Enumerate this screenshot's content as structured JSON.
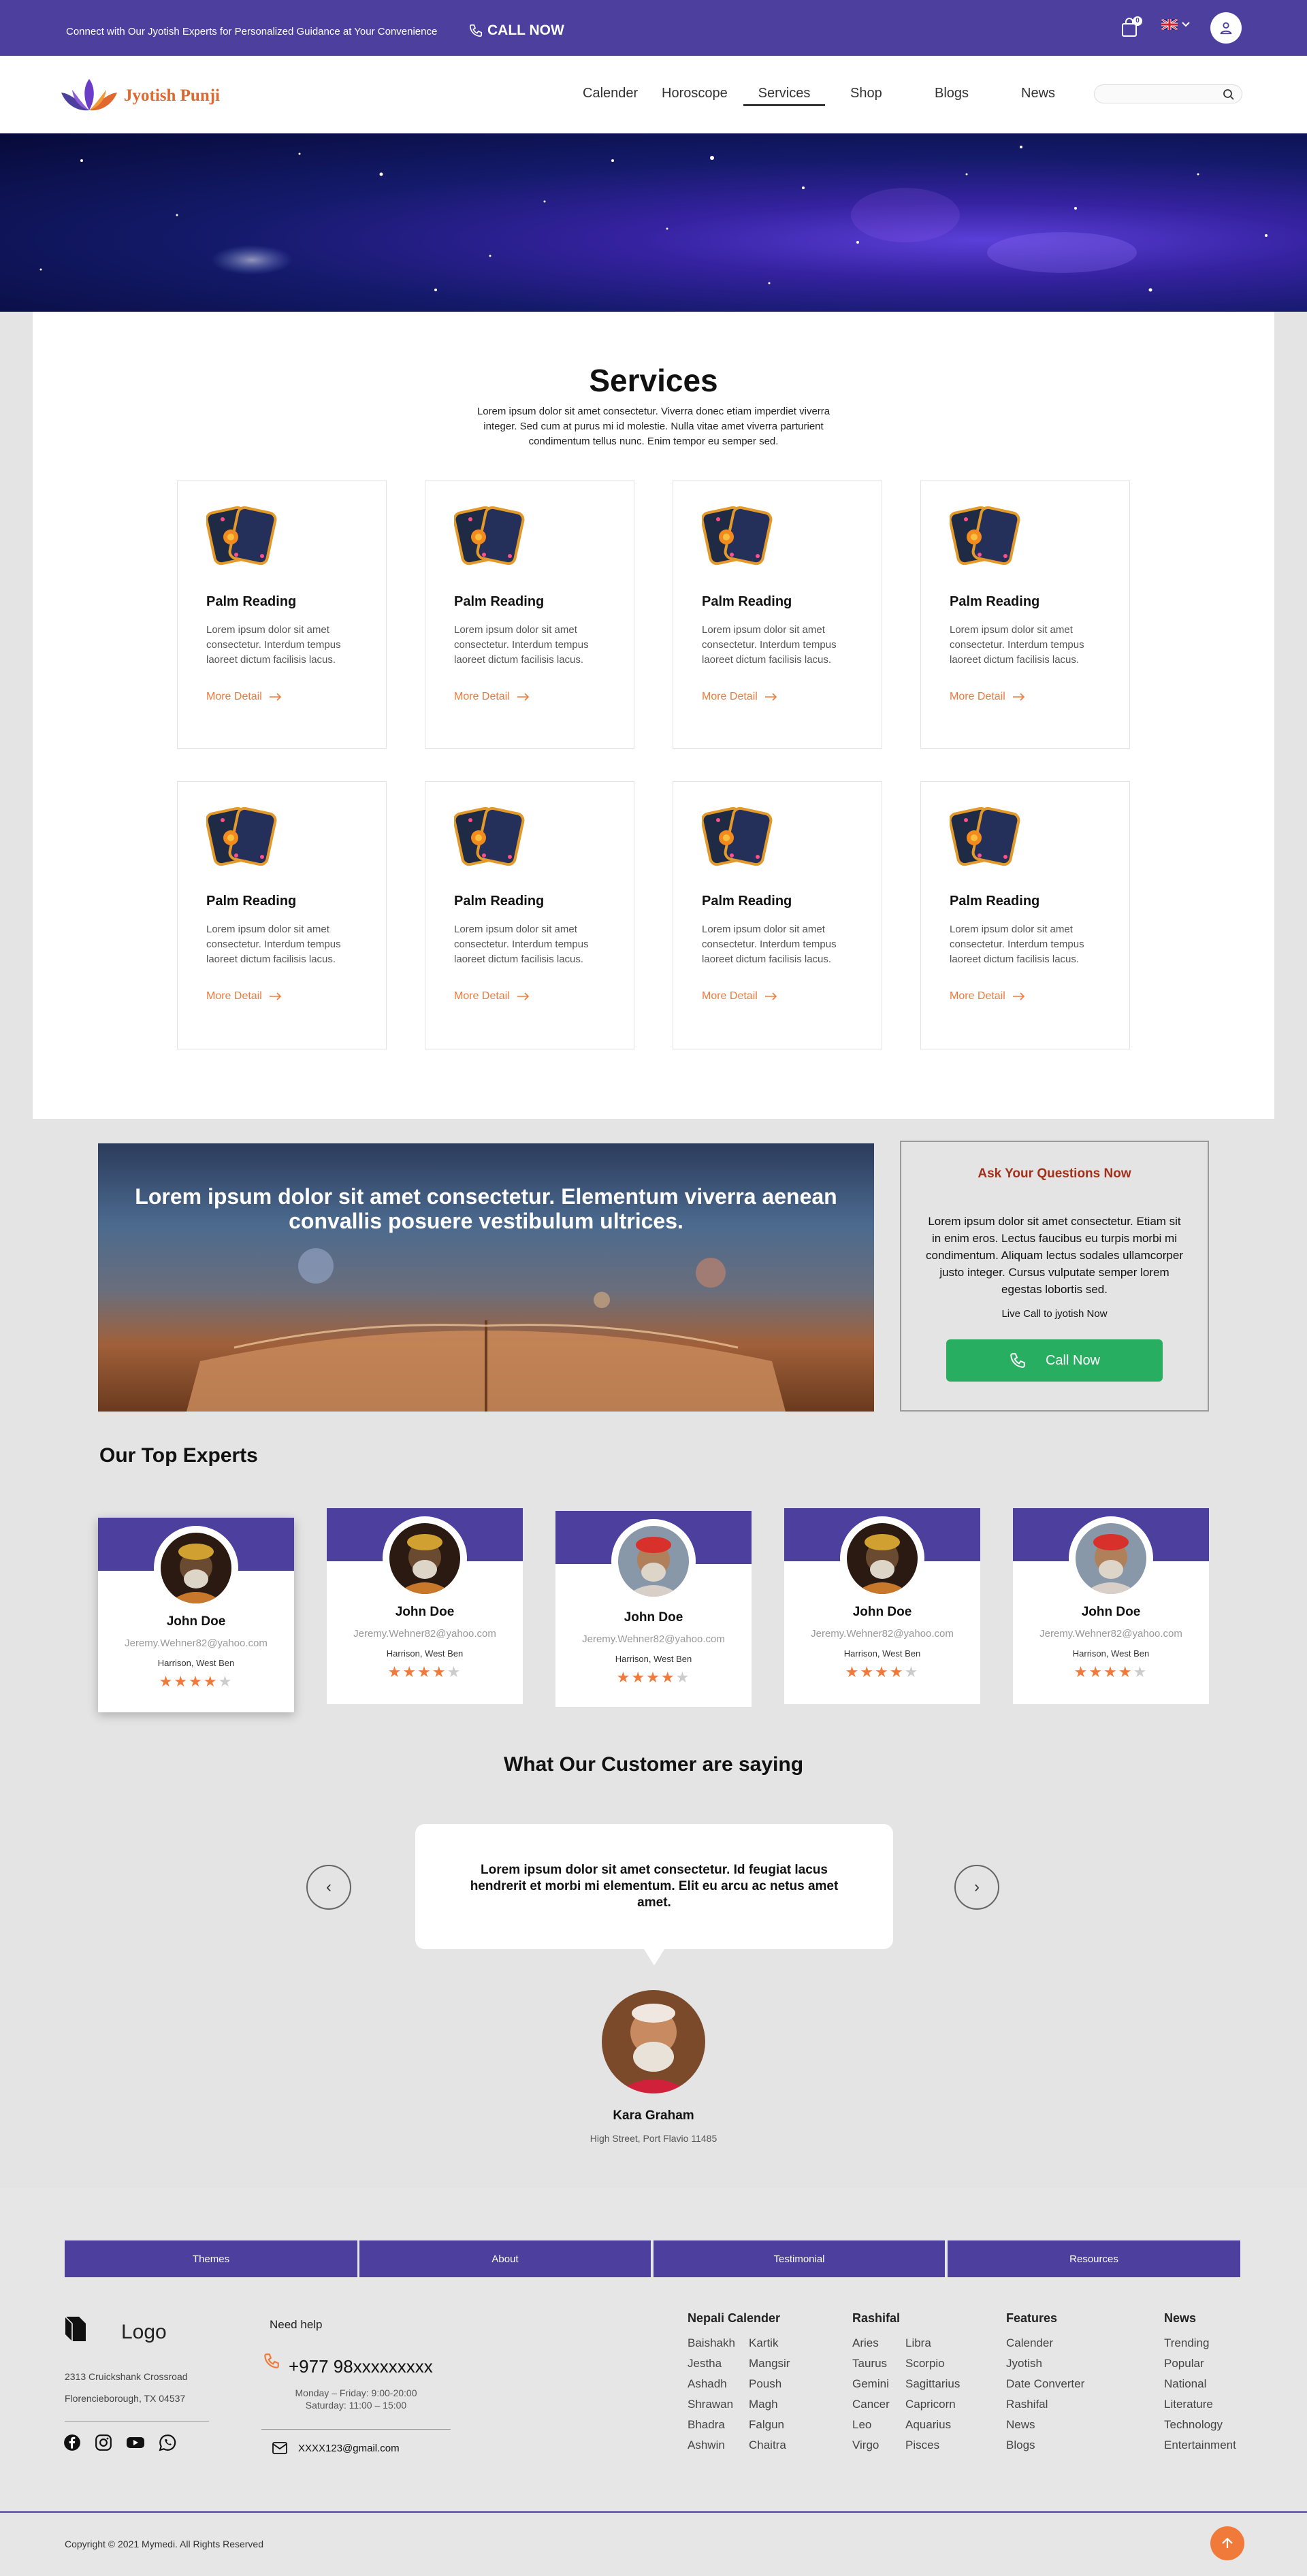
{
  "topbar": {
    "message": "Connect with Our Jyotish Experts for Personalized Guidance at Your Convenience",
    "call_label": "CALL NOW",
    "cart_count": "0"
  },
  "brand": {
    "name": "Jyotish Punji",
    "colors": {
      "primary": "#4d3f9e",
      "accent": "#f07a3a",
      "green": "#27ae60"
    }
  },
  "nav": {
    "items": [
      "Calender",
      "Horoscope",
      "Services",
      "Shop",
      "Blogs",
      "News"
    ],
    "active": "Services",
    "search_placeholder": ""
  },
  "services": {
    "title": "Services",
    "description": "Lorem ipsum dolor sit amet consectetur. Viverra donec etiam imperdiet viverra integer. Sed cum at purus mi id molestie. Nulla vitae amet viverra parturient condimentum tellus nunc. Enim tempor eu semper sed.",
    "cards": [
      {
        "title": "Palm Reading",
        "desc": "Lorem ipsum dolor sit amet consectetur. Interdum tempus laoreet dictum facilisis lacus.",
        "link": "More Detail"
      },
      {
        "title": "Palm Reading",
        "desc": "Lorem ipsum dolor sit amet consectetur. Interdum tempus laoreet dictum facilisis lacus.",
        "link": "More Detail"
      },
      {
        "title": "Palm Reading",
        "desc": "Lorem ipsum dolor sit amet consectetur. Interdum tempus laoreet dictum facilisis lacus.",
        "link": "More Detail"
      },
      {
        "title": "Palm Reading",
        "desc": "Lorem ipsum dolor sit amet consectetur. Interdum tempus laoreet dictum facilisis lacus.",
        "link": "More Detail"
      },
      {
        "title": "Palm Reading",
        "desc": "Lorem ipsum dolor sit amet consectetur. Interdum tempus laoreet dictum facilisis lacus.",
        "link": "More Detail"
      },
      {
        "title": "Palm Reading",
        "desc": "Lorem ipsum dolor sit amet consectetur. Interdum tempus laoreet dictum facilisis lacus.",
        "link": "More Detail"
      },
      {
        "title": "Palm Reading",
        "desc": "Lorem ipsum dolor sit amet consectetur. Interdum tempus laoreet dictum facilisis lacus.",
        "link": "More Detail"
      },
      {
        "title": "Palm Reading",
        "desc": "Lorem ipsum dolor sit amet consectetur. Interdum tempus laoreet dictum facilisis lacus.",
        "link": "More Detail"
      }
    ]
  },
  "banner": {
    "text": "Lorem ipsum dolor sit amet consectetur. Elementum viverra aenean convallis posuere vestibulum ultrices."
  },
  "ask": {
    "title": "Ask Your Questions Now",
    "desc": "Lorem ipsum dolor sit amet consectetur. Etiam sit in enim eros. Lectus faucibus eu turpis morbi mi condimentum. Aliquam lectus sodales ullamcorper justo integer. Cursus vulputate semper lorem egestas lobortis sed.",
    "live": "Live Call to jyotish Now",
    "button": "Call Now"
  },
  "experts": {
    "title": "Our Top Experts",
    "items": [
      {
        "name": "John Doe",
        "email": "Jeremy.Wehner82@yahoo.com",
        "location": "Harrison, West Ben",
        "rating": 3.5
      },
      {
        "name": "John Doe",
        "email": "Jeremy.Wehner82@yahoo.com",
        "location": "Harrison, West Ben",
        "rating": 3.5
      },
      {
        "name": "John Doe",
        "email": "Jeremy.Wehner82@yahoo.com",
        "location": "Harrison, West Ben",
        "rating": 3.5
      },
      {
        "name": "John Doe",
        "email": "Jeremy.Wehner82@yahoo.com",
        "location": "Harrison, West Ben",
        "rating": 3.5
      },
      {
        "name": "John Doe",
        "email": "Jeremy.Wehner82@yahoo.com",
        "location": "Harrison, West Ben",
        "rating": 3.5
      }
    ]
  },
  "testimonial": {
    "title": "What Our Customer are saying",
    "quote": "Lorem ipsum dolor sit amet consectetur. Id feugiat lacus hendrerit et morbi mi elementum. Elit eu arcu ac netus amet amet.",
    "name": "Kara Graham",
    "address": "High Street, Port Flavio 11485"
  },
  "footer": {
    "tabs": [
      "Themes",
      "About",
      "Testimonial",
      "Resources"
    ],
    "logo": "Logo",
    "address1": "2313 Cruickshank Crossroad",
    "address2": "Florencieborough, TX 04537",
    "help_title": "Need help",
    "phone": "+977 98xxxxxxxxx",
    "hours1": "Monday – Friday: 9:00-20:00",
    "hours2": "Saturday: 11:00 – 15:00",
    "email": "XXXX123@gmail.com",
    "cols": [
      {
        "title": "Nepali Calender",
        "a": [
          "Baishakh",
          "Jestha",
          "Ashadh",
          "Shrawan",
          "Bhadra",
          "Ashwin"
        ],
        "b": [
          "Kartik",
          "Mangsir",
          "Poush",
          "Magh",
          "Falgun",
          "Chaitra"
        ]
      },
      {
        "title": "Rashifal",
        "a": [
          "Aries",
          "Taurus",
          "Gemini",
          "Cancer",
          "Leo",
          "Virgo"
        ],
        "b": [
          "Libra",
          "Scorpio",
          "Sagittarius",
          "Capricorn",
          "Aquarius",
          "Pisces"
        ]
      },
      {
        "title": "Features",
        "a": [
          "Calender",
          "Jyotish",
          "Date Converter",
          "Rashifal",
          "News",
          "Blogs"
        ]
      },
      {
        "title": "News",
        "a": [
          "Trending",
          "Popular",
          "National",
          "Literature",
          "Technology",
          "Entertainment"
        ]
      }
    ],
    "copyright": "Copyright © 2021 Mymedi. All Rights Reserved"
  }
}
